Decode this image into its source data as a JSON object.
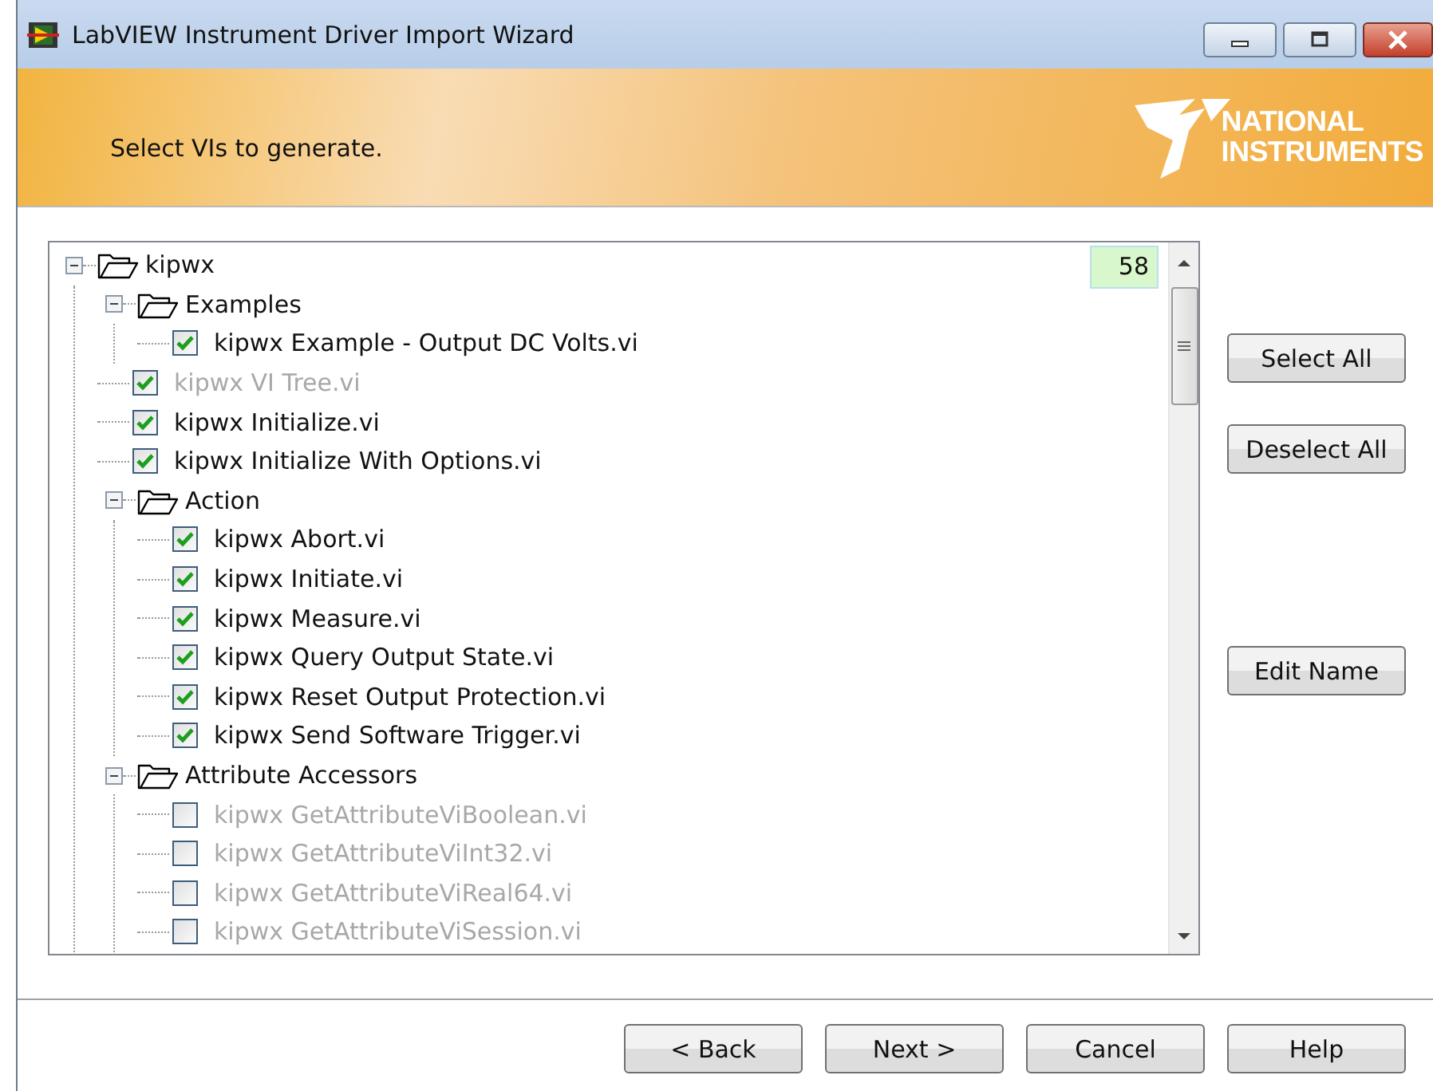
{
  "window": {
    "title": "LabVIEW Instrument Driver Import Wizard"
  },
  "header": {
    "instruction": "Select VIs to generate.",
    "logo_lines": [
      "NATIONAL",
      "INSTRUMENTS"
    ]
  },
  "tree": {
    "count": "58",
    "items": [
      {
        "label": "kipwx",
        "kind": "folder",
        "expanded": true,
        "children": [
          {
            "label": "Examples",
            "kind": "folder",
            "expanded": true,
            "children": [
              {
                "label": "kipwx Example - Output DC Volts.vi",
                "kind": "file",
                "checked": true,
                "disabled": false
              }
            ]
          },
          {
            "label": "kipwx VI Tree.vi",
            "kind": "file",
            "checked": true,
            "disabled": true
          },
          {
            "label": "kipwx Initialize.vi",
            "kind": "file",
            "checked": true,
            "disabled": false
          },
          {
            "label": "kipwx Initialize With Options.vi",
            "kind": "file",
            "checked": true,
            "disabled": false
          },
          {
            "label": "Action",
            "kind": "folder",
            "expanded": true,
            "children": [
              {
                "label": "kipwx Abort.vi",
                "kind": "file",
                "checked": true,
                "disabled": false
              },
              {
                "label": "kipwx Initiate.vi",
                "kind": "file",
                "checked": true,
                "disabled": false
              },
              {
                "label": "kipwx Measure.vi",
                "kind": "file",
                "checked": true,
                "disabled": false
              },
              {
                "label": "kipwx Query Output State.vi",
                "kind": "file",
                "checked": true,
                "disabled": false
              },
              {
                "label": "kipwx Reset Output Protection.vi",
                "kind": "file",
                "checked": true,
                "disabled": false
              },
              {
                "label": "kipwx Send Software Trigger.vi",
                "kind": "file",
                "checked": true,
                "disabled": false
              }
            ]
          },
          {
            "label": "Attribute Accessors",
            "kind": "folder",
            "expanded": true,
            "children": [
              {
                "label": "kipwx GetAttributeViBoolean.vi",
                "kind": "file",
                "checked": false,
                "disabled": true
              },
              {
                "label": "kipwx GetAttributeViInt32.vi",
                "kind": "file",
                "checked": false,
                "disabled": true
              },
              {
                "label": "kipwx GetAttributeViReal64.vi",
                "kind": "file",
                "checked": false,
                "disabled": true
              },
              {
                "label": "kipwx GetAttributeViSession.vi",
                "kind": "file",
                "checked": false,
                "disabled": true
              }
            ]
          }
        ]
      }
    ]
  },
  "side_buttons": [
    "Select All",
    "Deselect All",
    "Edit Name"
  ],
  "footer_buttons": [
    "< Back",
    "Next >",
    "Cancel",
    "Help"
  ]
}
